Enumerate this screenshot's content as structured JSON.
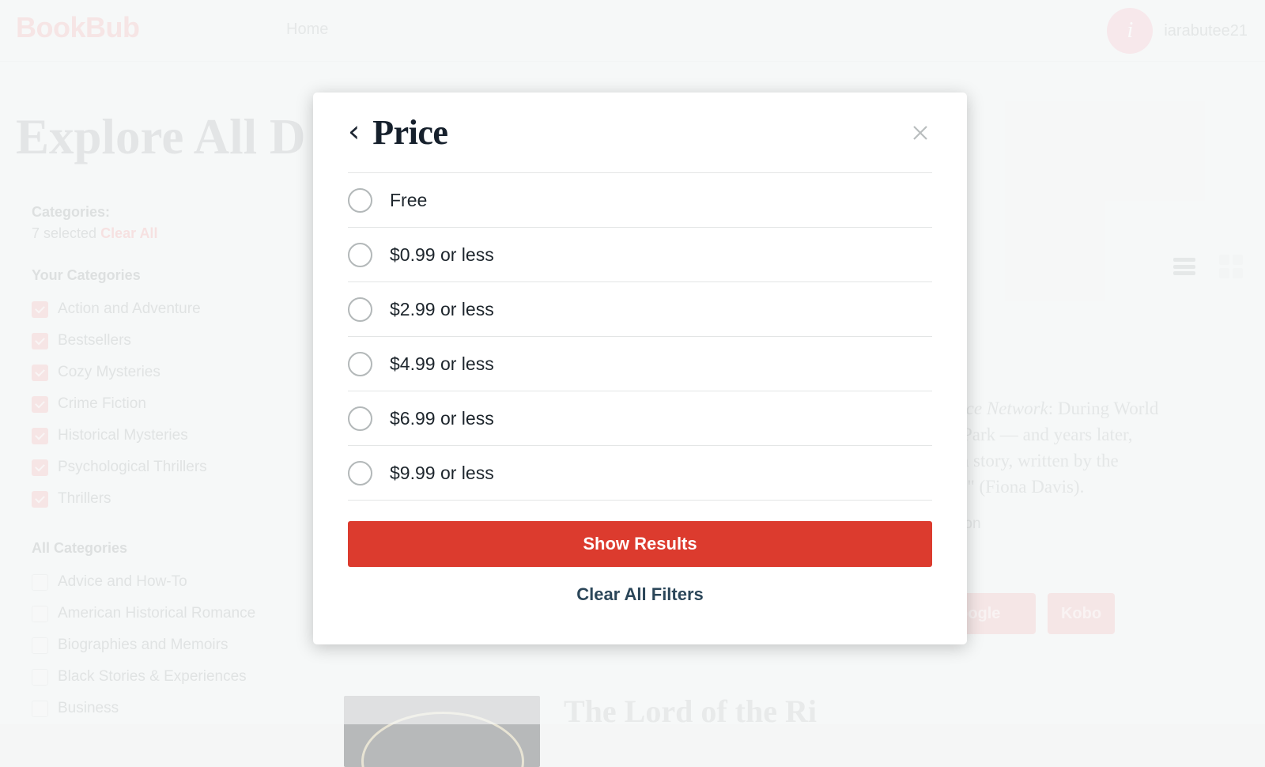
{
  "header": {
    "logo": "BookBub",
    "nav": [
      {
        "label": "Home"
      }
    ],
    "avatar_letter": "i",
    "username": "iarabutee21"
  },
  "main": {
    "page_title": "Explore All D",
    "view_toggles": {
      "list": "list-view-icon",
      "grid": "grid-view-icon"
    },
    "deal": {
      "description_title": "The Alice Network",
      "description_lines": [
        ": During World",
        "tchley Park — and years later,",
        "out of a story, written by the",
        "he ages\" (Fiona Davis)."
      ],
      "genre": "cal Fiction",
      "retailers": [
        "Google",
        "Kobo"
      ]
    },
    "next_book_title": "The Lord of the Ri"
  },
  "sidebar": {
    "categories_label": "Categories:",
    "selected_count": "7 selected",
    "clear_all": "Clear All",
    "your_categories_title": "Your Categories",
    "your_categories": [
      {
        "label": "Action and Adventure",
        "checked": true
      },
      {
        "label": "Bestsellers",
        "checked": true
      },
      {
        "label": "Cozy Mysteries",
        "checked": true
      },
      {
        "label": "Crime Fiction",
        "checked": true
      },
      {
        "label": "Historical Mysteries",
        "checked": true
      },
      {
        "label": "Psychological Thrillers",
        "checked": true
      },
      {
        "label": "Thrillers",
        "checked": true
      }
    ],
    "all_categories_title": "All Categories",
    "all_categories": [
      {
        "label": "Advice and How-To",
        "checked": false
      },
      {
        "label": "American Historical Romance",
        "checked": false
      },
      {
        "label": "Biographies and Memoirs",
        "checked": false
      },
      {
        "label": "Black Stories & Experiences",
        "checked": false
      },
      {
        "label": "Business",
        "checked": false
      }
    ]
  },
  "modal": {
    "title": "Price",
    "back_icon": "chevron-left-icon",
    "close_icon": "close-icon",
    "options": [
      {
        "label": "Free",
        "selected": false
      },
      {
        "label": "$0.99 or less",
        "selected": false
      },
      {
        "label": "$2.99 or less",
        "selected": false
      },
      {
        "label": "$4.99 or less",
        "selected": false
      },
      {
        "label": "$6.99 or less",
        "selected": false
      },
      {
        "label": "$9.99 or less",
        "selected": false
      }
    ],
    "show_results_label": "Show Results",
    "clear_all_filters_label": "Clear All Filters"
  },
  "colors": {
    "accent_red": "#dc3b2e",
    "brand_pink": "#f5c4c4",
    "link_navy": "#2b4659"
  }
}
